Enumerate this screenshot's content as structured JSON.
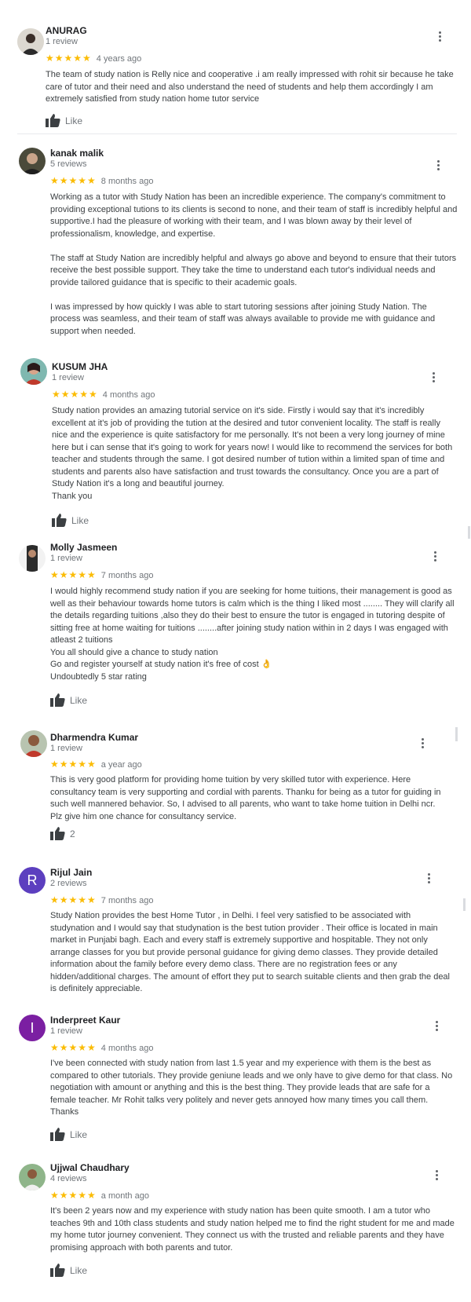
{
  "reviews": [
    {
      "name": "ANURAG",
      "count": "1 review",
      "stars": "★★★★★",
      "time": "4 years ago",
      "body": "The team of study nation is Relly nice and cooperative  .i am really impressed with rohit sir  because he take care of tutor and their need and also  understand the need of students and help them accordingly I am extremely satisfied from study nation home tutor service",
      "like": "Like",
      "avatar_icon": "person-photo-icon"
    },
    {
      "name": "kanak malik",
      "count": "5 reviews",
      "stars": "★★★★★",
      "time": "8 months ago",
      "body": "Working as a tutor with Study Nation has been an incredible experience. The company's commitment to providing exceptional tutions to its clients is second to none, and their team of staff is incredibly helpful and supportive.I had the pleasure of working with their team, and I was blown away by their level of professionalism, knowledge, and expertise.\n\nThe staff at Study Nation are incredibly helpful and always go above and beyond to ensure that their tutors receive the best possible support. They take the time to understand each tutor's individual needs and provide tailored guidance that is specific to their academic goals.\n\nI was impressed by how quickly I was able to start tutoring sessions after joining Study Nation. The process was seamless, and their team of staff was always available to provide me with guidance and support when needed.",
      "like": "",
      "avatar_icon": "person-photo-icon"
    },
    {
      "name": "KUSUM JHA",
      "count": "1 review",
      "stars": "★★★★★",
      "time": "4 months ago",
      "body": "Study nation provides an amazing tutorial service on it's side. Firstly i would say that it's incredibly excellent at it's job of providing the tution at the desired and tutor convenient locality. The staff is really nice and the experience is quite satisfactory for me personally. It's not been a very long journey of mine here but i can sense that it's going to work for years now! I would like to recommend the services for both teacher and students through the same. I got desired number of tution within a limited span of time and students and parents also have satisfaction and trust towards the consultancy. Once you are a part of Study Nation it's a long and beautiful journey.\nThank you",
      "like": "Like",
      "avatar_icon": "person-photo-icon"
    },
    {
      "name": "Molly Jasmeen",
      "count": "1 review",
      "stars": "★★★★★",
      "time": "7 months ago",
      "body": "I would highly recommend study nation if you are seeking for home tuitions, their management is good as well as their behaviour towards home tutors is calm which is the thing I liked most ........ They will clarify all the details regarding tuitions ,also they do their best to ensure the tutor is engaged in tutoring despite of sitting free at home waiting for tuitions ........after joining study nation within in 2 days I was engaged with atleast 2 tuitions\nYou all should give a chance to study nation\nGo and register yourself at study nation it's free of cost 👌\nUndoubtedly 5 star rating",
      "like": "Like",
      "avatar_icon": "person-photo-icon"
    },
    {
      "name": "Dharmendra Kumar",
      "count": "1 review",
      "stars": "★★★★★",
      "time": "a year ago",
      "body": "This is very good platform for providing home tuition by very skilled tutor with experience. Here consultancy team is very supporting and cordial with parents. Thanku for being as a tutor for guiding in such well mannered behavior. So, I advised to all parents, who want to take home tuition in Delhi ncr. Plz give  him one chance for consultancy service.",
      "like": "2",
      "avatar_icon": "person-photo-icon"
    },
    {
      "name": "Rijul Jain",
      "count": "2 reviews",
      "stars": "★★★★★",
      "time": "7 months ago",
      "body": "Study Nation provides the best Home Tutor , in Delhi. I feel very satisfied to be associated with studynation and I would say that studynation is the best tution provider . Their office is located in main market in Punjabi bagh. Each and every staff is extremely supportive and hospitable. They not only arrange classes for you but provide personal guidance for giving demo classes. They provide detailed information about the family before every demo class. There are no registration fees or any hidden/additional charges. The amount of effort they put to search suitable clients and then grab the deal is definitely appreciable.",
      "like": "",
      "avatar_letter": "R",
      "avatar_color": "#5c3fbf"
    },
    {
      "name": "Inderpreet Kaur",
      "count": "1 review",
      "stars": "★★★★★",
      "time": "4 months ago",
      "body": "I've been connected with study nation from last 1.5 year and my experience with them is the best as compared to other tutorials. They provide geniune leads and we only have to give demo for that class. No negotiation with amount or anything and this is the best thing. They provide leads that are safe for a female teacher. Mr Rohit talks very politely and never gets annoyed how many times you call them. Thanks",
      "like": "Like",
      "avatar_letter": "I",
      "avatar_color": "#7b1fa2"
    },
    {
      "name": "Ujjwal Chaudhary",
      "count": "4 reviews",
      "stars": "★★★★★",
      "time": "a month ago",
      "body": "It's been 2 years now and my experience with study nation has been quite smooth. I am a tutor who teaches 9th and 10th class students and study nation helped me to find the right student for me and made my home tutor journey convenient. They connect us with the trusted and reliable parents and they have promising approach with both parents and tutor.",
      "like": "Like",
      "avatar_icon": "person-photo-icon"
    }
  ],
  "colors": {
    "star": "#fbbc04",
    "muted": "#70757a",
    "text": "#3c4043"
  }
}
